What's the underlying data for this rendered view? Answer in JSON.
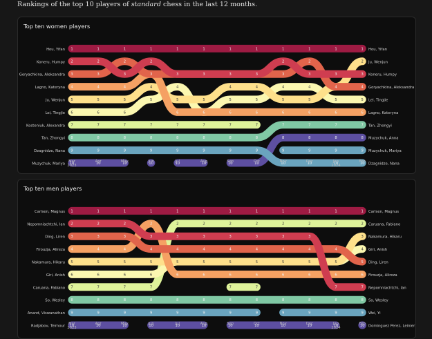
{
  "caption": {
    "prefix": "Rankings of the top 10 players of ",
    "emph": "standard",
    "suffix": " chess in the last 12 months."
  },
  "colors": {
    "background": "#171717",
    "card": "#0d0d0d",
    "rank_palette": [
      "#9e1b43",
      "#cf3d50",
      "#e1644b",
      "#f5a163",
      "#fee08b",
      "#fbf7b0",
      "#dff39a",
      "#80c8a4",
      "#6aa4be",
      "#5d4fa1"
    ]
  },
  "chart_data": [
    {
      "type": "bump",
      "title": "Top ten women players",
      "months": [
        "Mar\n2023",
        "Apr",
        "May",
        "Jun",
        "Jul",
        "Aug",
        "Sep",
        "Oct",
        "Nov",
        "Dec",
        "Jan\n2024",
        "Feb"
      ],
      "left_labels": [
        "Hou, Yifan",
        "Koneru, Humpy",
        "Goryachkina, Aleksandra",
        "Lagno, Kateryna",
        "Ju, Wenjun",
        "Lei, Tingjie",
        "Kosteniuk, Alexandra",
        "Tan, Zhongyi",
        "Dzagnidze, Nana",
        "Muzychuk, Mariya"
      ],
      "right_labels": [
        "Hou, Yifan",
        "Ju, Wenjun",
        "Koneru, Humpy",
        "Goryachkina, Aleksandra",
        "Lei, Tingjie",
        "Lagno, Kateryna",
        "Tan, Zhongyi",
        "Muzychuk, Anna",
        "Muzychuk, Mariya",
        "Dzagnidze, Nana"
      ],
      "series": [
        {
          "name": "Hou, Yifan",
          "ranks": [
            1,
            1,
            1,
            1,
            1,
            1,
            1,
            1,
            1,
            1,
            1,
            1
          ]
        },
        {
          "name": "Koneru, Humpy",
          "ranks": [
            2,
            2,
            3,
            2,
            3,
            3,
            3,
            3,
            2,
            3,
            3,
            3
          ]
        },
        {
          "name": "Goryachkina, Aleksandra",
          "ranks": [
            3,
            3,
            2,
            3,
            3,
            3,
            3,
            3,
            3,
            2,
            4,
            4
          ]
        },
        {
          "name": "Lagno, Kateryna",
          "ranks": [
            4,
            4,
            4,
            3,
            6,
            6,
            6,
            6,
            6,
            6,
            6,
            6
          ]
        },
        {
          "name": "Ju, Wenjun",
          "ranks": [
            5,
            5,
            5,
            4,
            5,
            5,
            4,
            4,
            5,
            5,
            4,
            2
          ]
        },
        {
          "name": "Lei, Tingjie",
          "ranks": [
            6,
            6,
            6,
            5,
            4,
            6,
            5,
            5,
            4,
            4,
            5,
            5
          ]
        },
        {
          "name": "Kosteniuk, Alexandra",
          "ranks": [
            7,
            7,
            7,
            7,
            7,
            7,
            7,
            7,
            null,
            null,
            null,
            null
          ]
        },
        {
          "name": "Tan, Zhongyi",
          "ranks": [
            8,
            8,
            8,
            8,
            8,
            8,
            8,
            8,
            7,
            7,
            7,
            7
          ]
        },
        {
          "name": "Dzagnidze, Nana",
          "ranks": [
            9,
            9,
            9,
            9,
            9,
            9,
            9,
            9,
            10,
            10,
            10,
            10
          ]
        },
        {
          "name": "Muzychuk, Mariya",
          "ranks": [
            10,
            10,
            10,
            null,
            null,
            null,
            null,
            null,
            null,
            null,
            null,
            null
          ]
        },
        {
          "name": "",
          "ranks": [
            null,
            null,
            null,
            10,
            null,
            null,
            null,
            null,
            null,
            null,
            null,
            null
          ]
        },
        {
          "name": "",
          "ranks": [
            null,
            null,
            null,
            null,
            10,
            10,
            null,
            null,
            null,
            null,
            null,
            null
          ]
        },
        {
          "name": "Muzychuk, Anna",
          "ranks": [
            null,
            null,
            null,
            null,
            null,
            null,
            10,
            10,
            8,
            8,
            8,
            8
          ]
        },
        {
          "name": "Muzychuk, Mariya",
          "ranks": [
            null,
            null,
            null,
            null,
            null,
            null,
            null,
            null,
            9,
            9,
            9,
            9
          ]
        }
      ]
    },
    {
      "type": "bump",
      "title": "Top ten men players",
      "months": [
        "Mar\n2023",
        "Apr",
        "May",
        "Jun",
        "Jul",
        "Aug",
        "Sep",
        "Oct",
        "Nov",
        "Dec",
        "Jan\n2024",
        "Feb"
      ],
      "left_labels": [
        "Carlsen, Magnus",
        "Nepomniachtchi, Ian",
        "Ding, Liren",
        "Firouzja, Alireza",
        "Nakamura, Hikaru",
        "Giri, Anish",
        "Caruana, Fabiano",
        "So, Wesley",
        "Anand, Viswanathan",
        "Radjabov, Teimour"
      ],
      "right_labels": [
        "Carlsen, Magnus",
        "Caruana, Fabiano",
        "Nakamura, Hikaru",
        "Giri, Anish",
        "Ding, Liren",
        "Firouzja, Alireza",
        "Nepomniachtchi, Ian",
        "So, Wesley",
        "Wei, Yi",
        "Dominguez Perez, Leinier"
      ],
      "series": [
        {
          "name": "Carlsen, Magnus",
          "ranks": [
            1,
            1,
            1,
            1,
            1,
            1,
            1,
            1,
            1,
            1,
            1,
            1
          ]
        },
        {
          "name": "Nepomniachtchi, Ian",
          "ranks": [
            2,
            2,
            2,
            3,
            3,
            3,
            3,
            3,
            3,
            3,
            7,
            7
          ]
        },
        {
          "name": "Ding, Liren",
          "ranks": [
            3,
            3,
            3,
            4,
            4,
            4,
            4,
            4,
            4,
            4,
            4,
            5
          ]
        },
        {
          "name": "Firouzja, Alireza",
          "ranks": [
            4,
            4,
            4,
            2,
            6,
            6,
            6,
            6,
            6,
            6,
            6,
            6
          ]
        },
        {
          "name": "Nakamura, Hikaru",
          "ranks": [
            5,
            5,
            5,
            5,
            5,
            5,
            5,
            5,
            5,
            5,
            5,
            3
          ]
        },
        {
          "name": "Giri, Anish",
          "ranks": [
            6,
            6,
            6,
            6,
            5,
            5,
            5,
            5,
            5,
            5,
            5,
            4
          ]
        },
        {
          "name": "Caruana, Fabiano",
          "ranks": [
            7,
            7,
            7,
            7,
            2,
            2,
            2,
            2,
            2,
            2,
            2,
            2
          ]
        },
        {
          "name": "So, Wesley",
          "ranks": [
            8,
            8,
            8,
            8,
            8,
            8,
            8,
            8,
            8,
            8,
            8,
            8
          ]
        },
        {
          "name": "Anand, Viswanathan",
          "ranks": [
            9,
            9,
            9,
            9,
            9,
            9,
            9,
            9,
            null,
            null,
            null,
            null
          ]
        },
        {
          "name": "Radjabov, Teimour",
          "ranks": [
            10,
            10,
            10,
            null,
            null,
            null,
            null,
            null,
            null,
            null,
            null,
            null
          ]
        },
        {
          "name": "",
          "ranks": [
            null,
            null,
            null,
            10,
            10,
            10,
            null,
            null,
            null,
            null,
            null,
            null
          ]
        },
        {
          "name": "",
          "ranks": [
            null,
            null,
            null,
            null,
            null,
            null,
            7,
            7,
            null,
            null,
            null,
            null
          ]
        },
        {
          "name": "",
          "ranks": [
            null,
            null,
            null,
            null,
            null,
            null,
            10,
            10,
            10,
            10,
            10,
            null
          ]
        },
        {
          "name": "Wei, Yi",
          "ranks": [
            null,
            null,
            null,
            null,
            null,
            null,
            null,
            null,
            9,
            9,
            9,
            9
          ]
        },
        {
          "name": "Dominguez Perez, Leinier",
          "ranks": [
            null,
            null,
            null,
            null,
            null,
            null,
            null,
            null,
            null,
            null,
            null,
            10
          ]
        }
      ]
    }
  ]
}
